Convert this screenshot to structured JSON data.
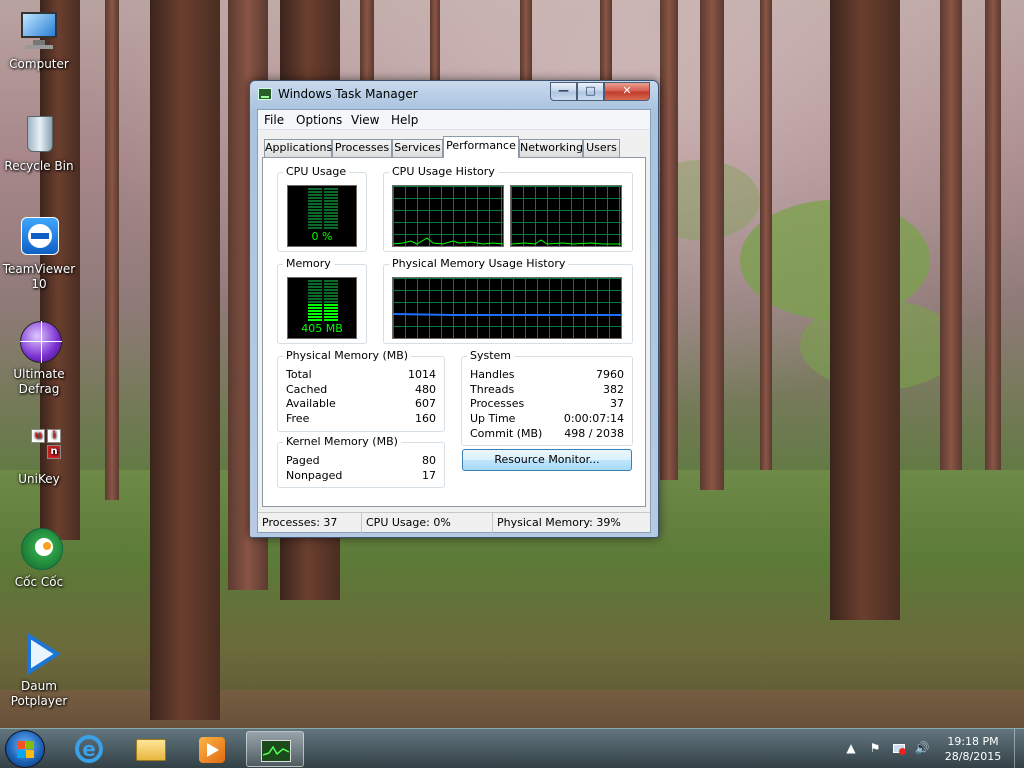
{
  "desktop_icons": [
    {
      "label": "Computer",
      "icon": "computer-icon"
    },
    {
      "label": "Recycle Bin",
      "icon": "recycle-bin-icon"
    },
    {
      "label": "TeamViewer 10",
      "icon": "teamviewer-icon"
    },
    {
      "label": "Ultimate Defrag",
      "icon": "defrag-icon"
    },
    {
      "label": "UniKey",
      "icon": "unikey-icon"
    },
    {
      "label": "Cốc Cốc",
      "icon": "coccoc-icon"
    },
    {
      "label": "Daum Potplayer",
      "icon": "potplayer-icon"
    }
  ],
  "window": {
    "title": "Windows Task Manager",
    "menu": [
      "File",
      "Options",
      "View",
      "Help"
    ],
    "tabs": [
      "Applications",
      "Processes",
      "Services",
      "Performance",
      "Networking",
      "Users"
    ],
    "active_tab": "Performance",
    "cpu_usage": {
      "label": "CPU Usage",
      "value": "0 %",
      "percent": 0
    },
    "cpu_history": {
      "label": "CPU Usage History"
    },
    "memory": {
      "label": "Memory",
      "value": "405 MB",
      "fraction": 0.4
    },
    "mem_history": {
      "label": "Physical Memory Usage History",
      "level_fraction": 0.4
    },
    "physical_memory": {
      "label": "Physical Memory (MB)",
      "rows": [
        {
          "k": "Total",
          "v": "1014"
        },
        {
          "k": "Cached",
          "v": "480"
        },
        {
          "k": "Available",
          "v": "607"
        },
        {
          "k": "Free",
          "v": "160"
        }
      ]
    },
    "kernel_memory": {
      "label": "Kernel Memory (MB)",
      "rows": [
        {
          "k": "Paged",
          "v": "80"
        },
        {
          "k": "Nonpaged",
          "v": "17"
        }
      ]
    },
    "system": {
      "label": "System",
      "rows": [
        {
          "k": "Handles",
          "v": "7960"
        },
        {
          "k": "Threads",
          "v": "382"
        },
        {
          "k": "Processes",
          "v": "37"
        },
        {
          "k": "Up Time",
          "v": "0:00:07:14"
        },
        {
          "k": "Commit (MB)",
          "v": "498 / 2038"
        }
      ]
    },
    "resource_monitor_label": "Resource Monitor...",
    "status": {
      "processes": "Processes: 37",
      "cpu": "CPU Usage: 0%",
      "memory": "Physical Memory: 39%"
    }
  },
  "taskbar": {
    "pinned": [
      "internet-explorer-icon",
      "file-explorer-icon",
      "media-player-icon",
      "task-manager-icon"
    ],
    "clock_time": "19:18 PM",
    "clock_date": "28/8/2015"
  },
  "colors": {
    "graph_line": "#00ff00",
    "memory_line": "#1e6fff",
    "graph_grid": "#0a7a3a"
  }
}
